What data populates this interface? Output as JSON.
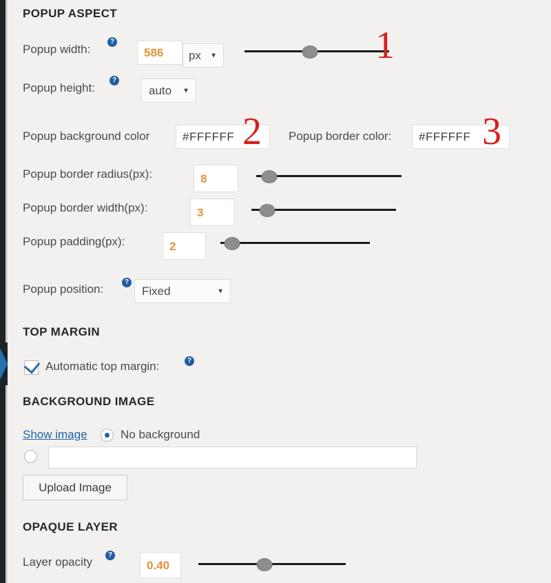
{
  "sections": {
    "popup_aspect": "POPUP ASPECT",
    "top_margin": "TOP MARGIN",
    "background_image": "BACKGROUND IMAGE",
    "opaque_layer": "OPAQUE LAYER"
  },
  "fields": {
    "popup_width": {
      "label": "Popup width:",
      "value": "586",
      "unit": "px",
      "help": "?",
      "slider_percent": 45
    },
    "popup_height": {
      "label": "Popup height:",
      "value": "auto",
      "help": "?"
    },
    "popup_background_color": {
      "label": "Popup background color",
      "value": "#FFFFFF"
    },
    "popup_border_color": {
      "label": "Popup border color:",
      "value": "#FFFFFF"
    },
    "popup_border_radius": {
      "label": "Popup border radius(px):",
      "value": "8",
      "slider_percent": 9
    },
    "popup_border_width": {
      "label": "Popup border width(px):",
      "value": "3",
      "slider_percent": 11
    },
    "popup_padding": {
      "label": "Popup padding(px):",
      "value": "2",
      "slider_percent": 8
    },
    "popup_position": {
      "label": "Popup position:",
      "value": "Fixed",
      "help": "?"
    },
    "automatic_top_margin": {
      "label": "Automatic top margin:",
      "help": "?",
      "checked": true
    },
    "show_image_link": "Show image",
    "no_background": {
      "label": "No background",
      "selected": true
    },
    "image_path": {
      "value": "",
      "selected": false
    },
    "upload_button": "Upload Image",
    "layer_opacity": {
      "label": "Layer opacity",
      "value": "0.40",
      "help": "?",
      "slider_percent": 45
    }
  },
  "annotations": {
    "one": "1",
    "two": "2",
    "three": "3"
  },
  "colors": {
    "accent_blue": "#1f5f9e",
    "value_orange": "#e2933a",
    "annotation_red": "#d61f1f",
    "page_background": "#f2f1f0",
    "rail_dark": "#1d2327"
  }
}
